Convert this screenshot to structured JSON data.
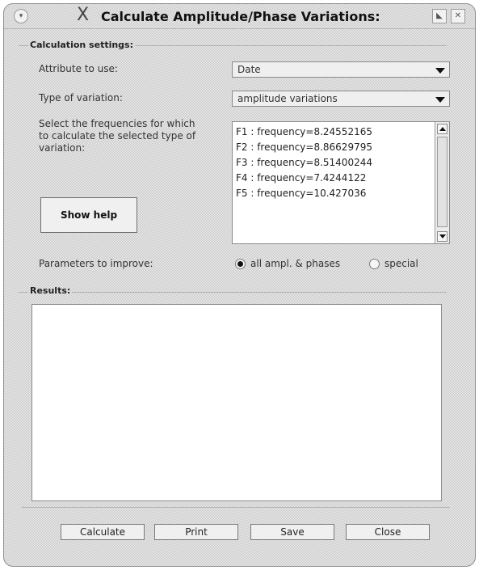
{
  "window": {
    "title": "Calculate Amplitude/Phase Variations:",
    "x_logo": "X",
    "icons": {
      "menu": "chevron-down-icon",
      "minimize": "minimize-icon",
      "close": "close-icon"
    }
  },
  "settings": {
    "group_title": "Calculation settings:",
    "attribute_label": "Attribute to use:",
    "attribute_value": "Date",
    "variation_label": "Type of variation:",
    "variation_value": "amplitude variations",
    "freq_label_lines": [
      "Select the frequencies for which",
      "to calculate the selected type of",
      "variation:"
    ],
    "frequencies": [
      "F1  : frequency=8.24552165",
      "F2  : frequency=8.86629795",
      "F3  : frequency=8.51400244",
      "F4  : frequency=7.4244122",
      "F5  : frequency=10.427036"
    ],
    "help_button": "Show help",
    "params_label": "Parameters to improve:",
    "params_options": [
      {
        "label": "all ampl. & phases",
        "checked": true
      },
      {
        "label": "special",
        "checked": false
      }
    ]
  },
  "results": {
    "group_title": "Results:",
    "content": ""
  },
  "buttons": {
    "calculate": "Calculate",
    "print": "Print",
    "save": "Save",
    "close": "Close"
  }
}
